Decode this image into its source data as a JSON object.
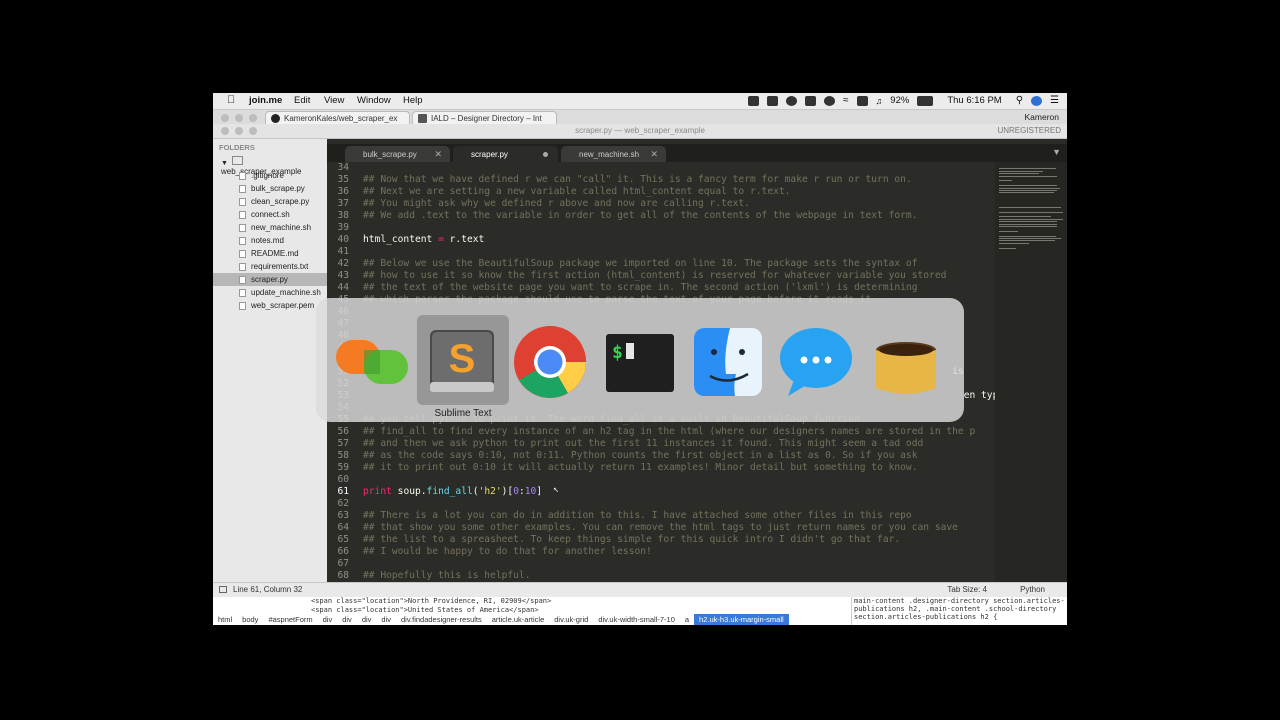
{
  "menubar": {
    "app": "join.me",
    "items": [
      "Edit",
      "View",
      "Window",
      "Help"
    ],
    "battery": "92%",
    "clock": "Thu 6:16 PM"
  },
  "browser": {
    "tabs": [
      "KameronKales/web_scraper_ex",
      "IALD – Designer Directory – Int"
    ],
    "user": "Kameron"
  },
  "window": {
    "title": "scraper.py — web_scraper_example",
    "unregistered": "UNREGISTERED"
  },
  "sidebar": {
    "header": "FOLDERS",
    "folder": "web_scraper_example",
    "files": [
      ".gitignore",
      "bulk_scrape.py",
      "clean_scrape.py",
      "connect.sh",
      "new_machine.sh",
      "notes.md",
      "README.md",
      "requirements.txt",
      "scraper.py",
      "update_machine.sh",
      "web_scraper.pem"
    ],
    "selected": "scraper.py"
  },
  "editor_tabs": [
    {
      "label": "bulk_scrape.py",
      "state": "close"
    },
    {
      "label": "scraper.py",
      "state": "dirty"
    },
    {
      "label": "new_machine.sh",
      "state": "close"
    }
  ],
  "code_lines": [
    {
      "n": "34",
      "t": ""
    },
    {
      "n": "35",
      "t": "## Now that we have defined r we can \"call\" it. This is a fancy term for make r run or turn on."
    },
    {
      "n": "36",
      "t": "## Next we are setting a new variable called html_content equal to r.text."
    },
    {
      "n": "37",
      "t": "## You might ask why we defined r above and now are calling r.text."
    },
    {
      "n": "38",
      "t": "## We add .text to the variable in order to get all of the contents of the webpage in text form."
    },
    {
      "n": "39",
      "t": ""
    },
    {
      "n": "40",
      "t": "html_content = r.text"
    },
    {
      "n": "41",
      "t": ""
    },
    {
      "n": "42",
      "t": "## Below we use the BeautifulSoup package we imported on line 10. The package sets the syntax of"
    },
    {
      "n": "43",
      "t": "## how to use it so know the first action (html_content) is reserved for whatever variable you stored"
    },
    {
      "n": "44",
      "t": "## the text of the website page you want to scrape in. The second action ('lxml') is determining"
    },
    {
      "n": "45",
      "t": "## which parser the package should use to parse the text of your page before it reads it..."
    },
    {
      "n": "46",
      "t": ""
    },
    {
      "n": "47",
      "t": ""
    },
    {
      "n": "48",
      "t": ""
    },
    {
      "n": "49",
      "t": ""
    },
    {
      "n": "50",
      "t": ""
    },
    {
      "n": "51",
      "t": "                                                                                                      is"
    },
    {
      "n": "52",
      "t": ""
    },
    {
      "n": "53",
      "t": "                                                                                                        en typ"
    },
    {
      "n": "54",
      "t": ""
    },
    {
      "n": "55",
      "t": "## you tell python to print it. The word find_all is a built in BeautifulSoup function"
    },
    {
      "n": "56",
      "t": "## find_all to find every instance of an h2 tag in the html (where our designers names are stored in the p"
    },
    {
      "n": "57",
      "t": "## and then we ask python to print out the first 11 instances it found. This might seem a tad odd"
    },
    {
      "n": "58",
      "t": "## as the code says 0:10, not 0:11. Python counts the first object in a list as 0. So if you ask"
    },
    {
      "n": "59",
      "t": "## it to print out 0:10 it will actually return 11 examples! Minor detail but something to know."
    },
    {
      "n": "60",
      "t": ""
    },
    {
      "n": "61",
      "t": "print soup.find_all('h2')[0:10]"
    },
    {
      "n": "62",
      "t": ""
    },
    {
      "n": "63",
      "t": "## There is a lot you can do in addition to this. I have attached some other files in this repo"
    },
    {
      "n": "64",
      "t": "## that show you some other examples. You can remove the html tags to just return names or you can save"
    },
    {
      "n": "65",
      "t": "## the list to a spreasheet. To keep things simple for this quick intro I didn't go that far."
    },
    {
      "n": "66",
      "t": "## I would be happy to do that for another lesson!"
    },
    {
      "n": "67",
      "t": ""
    },
    {
      "n": "68",
      "t": "## Hopefully this is helpful."
    }
  ],
  "statusbar": {
    "position": "Line 61, Column 32",
    "tab_size": "Tab Size: 4",
    "syntax": "Python"
  },
  "devtools": {
    "source_line_1": "<span class=\"location\">North Providence, RI, 02909</span>",
    "source_line_2": "<span class=\"location\">United States of America</span>",
    "breadcrumbs": [
      "html",
      "body",
      "#aspnetForm",
      "div",
      "div",
      "div",
      "div",
      "div.findadesigner-results",
      "article.uk-article",
      "div.uk-grid",
      "div.uk-width-small-7-10",
      "a",
      "h2.uk-h3.uk-margin-small"
    ],
    "css_text": "main-content .designer-directory section.articles-publications h2, .main-content .school-directory section.articles-publications h2 {"
  },
  "switcher": {
    "apps": [
      "join.me",
      "Sublime Text",
      "Google Chrome",
      "Terminal",
      "Finder",
      "Messages",
      "Homebrew"
    ],
    "selected_label": "Sublime Text"
  }
}
